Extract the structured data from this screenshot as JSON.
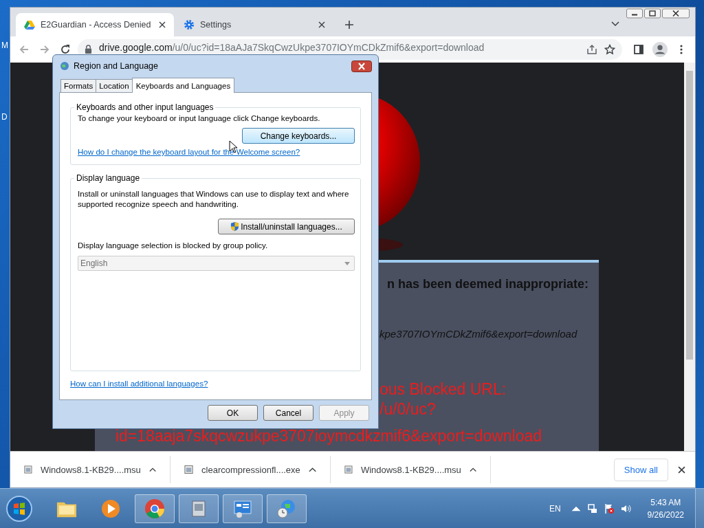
{
  "desktop": {
    "icon_labels": [
      "M",
      "D"
    ]
  },
  "browser": {
    "tabs": [
      {
        "title": "E2Guardian - Access Denied",
        "selected": true
      },
      {
        "title": "Settings",
        "selected": false
      }
    ],
    "address": {
      "host": "drive.google.com",
      "path": "/u/0/uc?id=18aAJa7SkqCwzUkpe3707IOYmCDkZmif6&export=download"
    },
    "page": {
      "heading": "n has been deemed inappropriate:",
      "url_fragment": "kpe3707IOYmCDkZmif6&export=download",
      "blocked_lines": [
        "ous  Blocked URL:",
        "/u/0/uc?",
        "id=18aaja7skqcwzukpe3707ioymcdkzmif6&export=download"
      ]
    },
    "downloads": [
      {
        "name": "Windows8.1-KB29....msu"
      },
      {
        "name": "clearcompressionfl....exe"
      },
      {
        "name": "Windows8.1-KB29....msu"
      }
    ],
    "show_all": "Show all"
  },
  "dialog": {
    "title": "Region and Language",
    "tabs": [
      {
        "label": "Formats",
        "selected": false
      },
      {
        "label": "Location",
        "selected": false
      },
      {
        "label": "Keyboards and Languages",
        "selected": true
      }
    ],
    "keyboards_group": {
      "title": "Keyboards and other input languages",
      "text": "To change your keyboard or input language click Change keyboards.",
      "button": "Change keyboards...",
      "link": "How do I change the keyboard layout for the Welcome screen?"
    },
    "display_group": {
      "title": "Display language",
      "text": "Install or uninstall languages that Windows can use to display text and where supported recognize speech and handwriting.",
      "button": "Install/uninstall languages...",
      "policy_text": "Display language selection is blocked by group policy.",
      "language": {
        "value": "English",
        "disabled": true
      }
    },
    "bottom_link": "How can I install additional languages?",
    "buttons": [
      {
        "label": "OK",
        "disabled": false
      },
      {
        "label": "Cancel",
        "disabled": false
      },
      {
        "label": "Apply",
        "disabled": true
      }
    ]
  },
  "taskbar": {
    "language": "EN",
    "time": "5:43 AM",
    "date": "9/26/2022"
  }
}
